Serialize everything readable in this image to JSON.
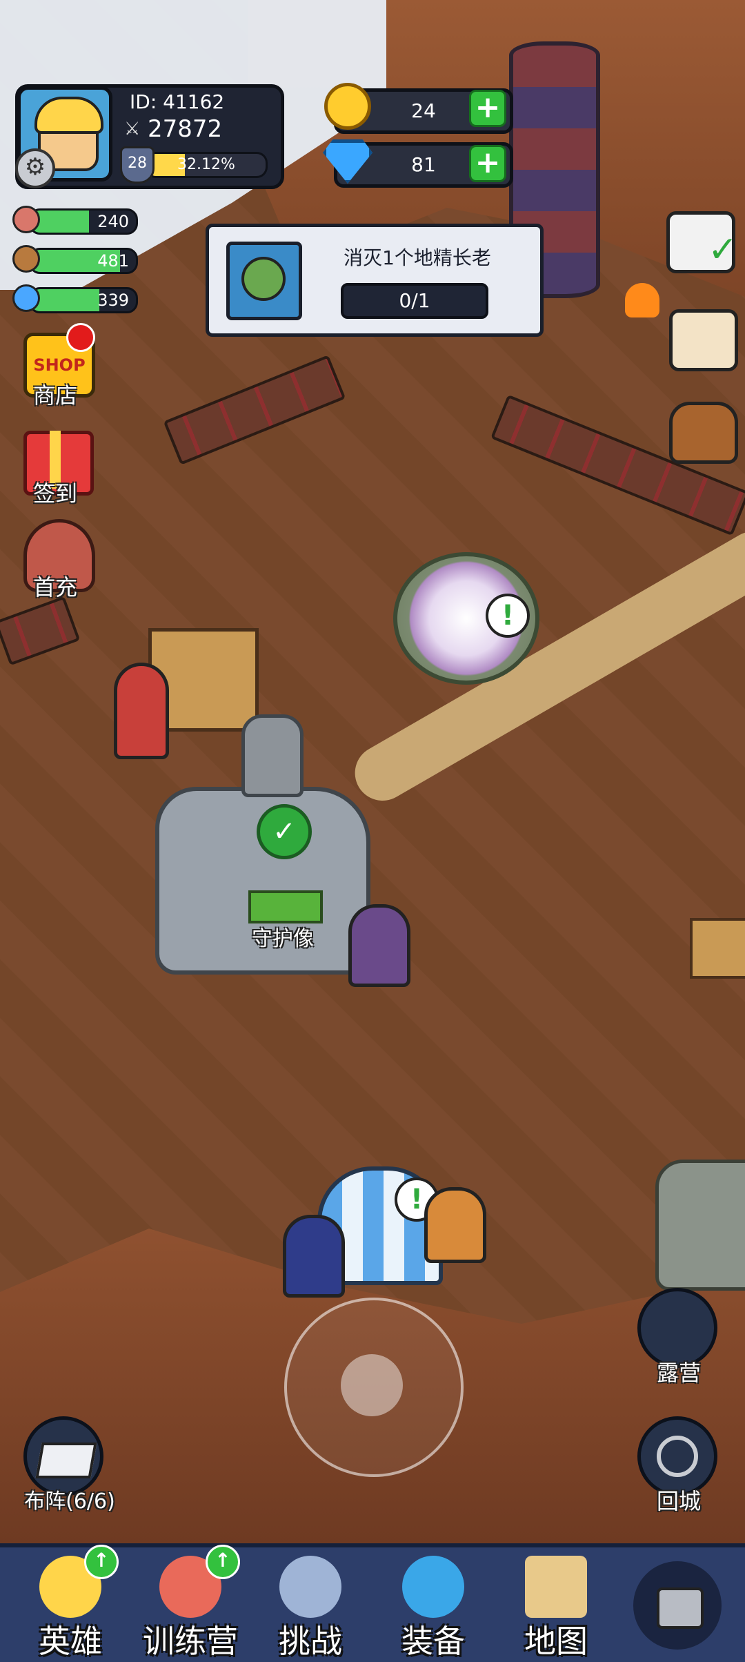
{
  "player": {
    "id_label": "ID: 41162",
    "power": "27872",
    "level": "28",
    "xp_percent_text": "32.12%",
    "xp_fraction": 0.3212
  },
  "currency": {
    "gold": "24",
    "diamonds": "81"
  },
  "resources": [
    {
      "name": "meat",
      "value": "240",
      "fill": 0.55,
      "color": "#d9776b"
    },
    {
      "name": "wood",
      "value": "481",
      "fill": 0.85,
      "color": "#b87a3e"
    },
    {
      "name": "crystal",
      "value": "339",
      "fill": 0.65,
      "color": "#4aa7ff"
    }
  ],
  "quest": {
    "title": "消灭1个地精长老",
    "progress": "0/1"
  },
  "left_menu": {
    "shop_label": "商店",
    "shop_icon_text": "SHOP",
    "signin_label": "签到",
    "firstpay_label": "首充"
  },
  "map": {
    "statue_label": "守护像",
    "camp_label": "露营",
    "return_label": "回城",
    "formation_label": "布阵(6/6)"
  },
  "tabs": {
    "heroes": "英雄",
    "training": "训练营",
    "challenge": "挑战",
    "equipment": "装备",
    "map": "地图"
  },
  "colors": {
    "accent_green": "#33c13e",
    "xp_yellow": "#ffd84a",
    "hud_dark": "#1f2433",
    "tab_bar": "#2d3e6a"
  }
}
